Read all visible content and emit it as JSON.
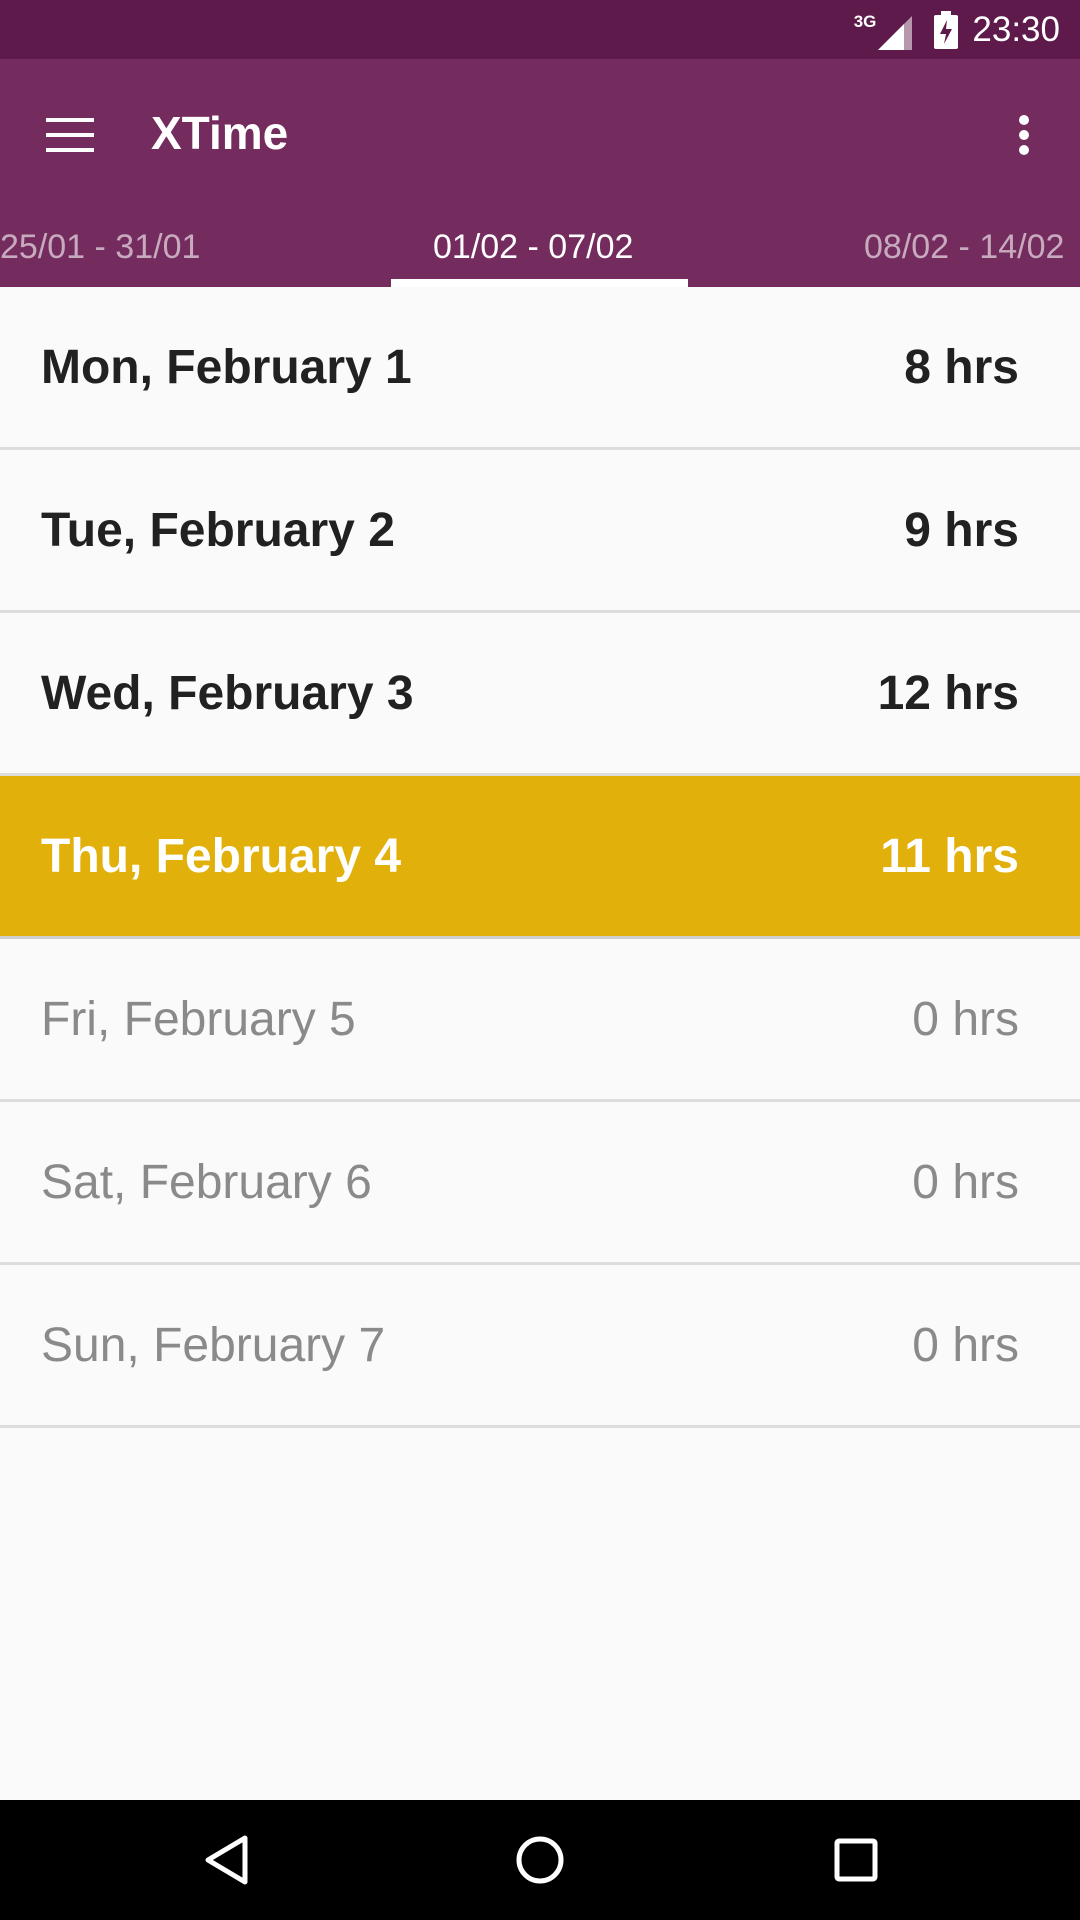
{
  "status_bar": {
    "network": "3G",
    "time": "23:30",
    "icons": [
      "signal-icon",
      "battery-icon"
    ]
  },
  "app_bar": {
    "title": "XTime",
    "icons": [
      "menu-icon",
      "overflow-menu-icon"
    ],
    "color": "#742b5e",
    "status_color": "#5e1a4a"
  },
  "tabs": [
    {
      "label": "25/01 - 31/01",
      "selected": false
    },
    {
      "label": "01/02 - 07/02",
      "selected": true
    },
    {
      "label": "08/02 - 14/02",
      "selected": false
    }
  ],
  "days": [
    {
      "label": "Mon, February 1",
      "hours": "8 hrs",
      "state": "active"
    },
    {
      "label": "Tue, February 2",
      "hours": "9 hrs",
      "state": "active"
    },
    {
      "label": "Wed, February 3",
      "hours": "12 hrs",
      "state": "active"
    },
    {
      "label": "Thu, February 4",
      "hours": "11 hrs",
      "state": "selected"
    },
    {
      "label": "Fri, February 5",
      "hours": "0 hrs",
      "state": "future"
    },
    {
      "label": "Sat, February 6",
      "hours": "0 hrs",
      "state": "future"
    },
    {
      "label": "Sun, February 7",
      "hours": "0 hrs",
      "state": "future"
    }
  ],
  "colors": {
    "highlight": "#e1b00a",
    "text_primary": "#212121",
    "text_disabled": "#8a8a8a"
  },
  "nav_bar": {
    "icons": [
      "back-icon",
      "home-icon",
      "recents-icon"
    ]
  }
}
